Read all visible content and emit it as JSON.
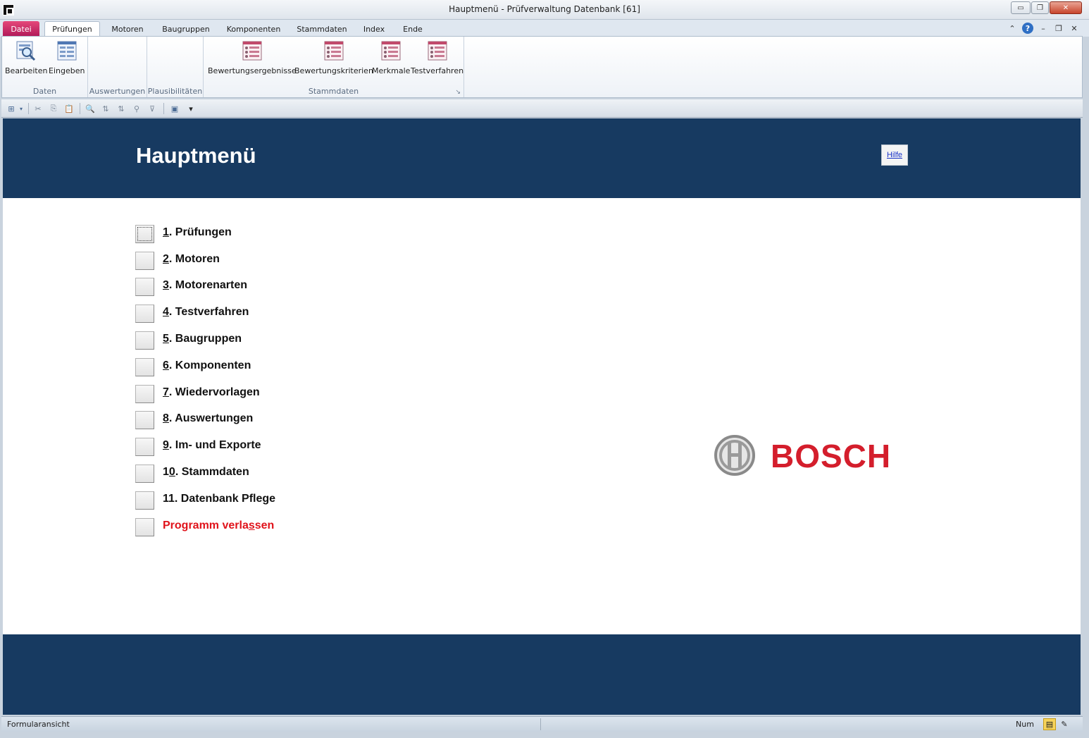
{
  "window": {
    "title": "Hauptmenü  -  Prüfverwaltung Datenbank [61]",
    "min_glyph": "▭",
    "max_glyph": "❐",
    "close_glyph": "✕"
  },
  "tabs": {
    "file": "Datei",
    "items": [
      "Prüfungen",
      "Motoren",
      "Baugruppen",
      "Komponenten",
      "Stammdaten",
      "Index",
      "Ende"
    ],
    "right_icons": [
      "⌃",
      "?",
      "–",
      "❐",
      "✕"
    ]
  },
  "ribbon": {
    "groups": {
      "daten": "Daten",
      "auswertungen": "Auswertungen",
      "plausibilitaeten": "Plausibilitäten",
      "stammdaten": "Stammdaten"
    },
    "buttons": {
      "bearbeiten": "Bearbeiten",
      "eingeben": "Eingeben",
      "bewertungsergebnisse": "Bewertungsergebnisse",
      "bewertungskriterien": "Bewertungskriterien",
      "merkmale": "Merkmale",
      "testverfahren": "Testverfahren"
    },
    "launcher_glyph": "↘"
  },
  "qat": {
    "icons": [
      "⊞",
      "✂",
      "⎘",
      "📋",
      "🔍",
      "⇅",
      "⇅",
      "⚲",
      "⊽",
      "▣",
      "▾"
    ]
  },
  "form": {
    "title": "Hauptmenü",
    "help": "Hilfe",
    "menu": [
      {
        "key": "1",
        "rest": ". Prüfungen"
      },
      {
        "key": "2",
        "rest": ". Motoren"
      },
      {
        "key": "3",
        "rest": ". Motorenarten"
      },
      {
        "key": "4",
        "rest": ". Testverfahren"
      },
      {
        "key": "5",
        "rest": ". Baugruppen"
      },
      {
        "key": "6",
        "rest": ". Komponenten"
      },
      {
        "key": "7",
        "rest": ". Wiedervorlagen"
      },
      {
        "key": "8",
        "rest": ". Auswertungen"
      },
      {
        "key": "9",
        "rest": ". Im- und Exporte"
      },
      {
        "pre": "1",
        "key": "0",
        "rest": ". Stammdaten"
      },
      {
        "pre": "11. Datenbank Pflege",
        "key": "",
        "rest": ""
      },
      {
        "pre": "Programm verla",
        "key": "s",
        "rest": "sen"
      }
    ],
    "logo": "BOSCH"
  },
  "status": {
    "view": "Formularansicht",
    "num": "Num"
  }
}
